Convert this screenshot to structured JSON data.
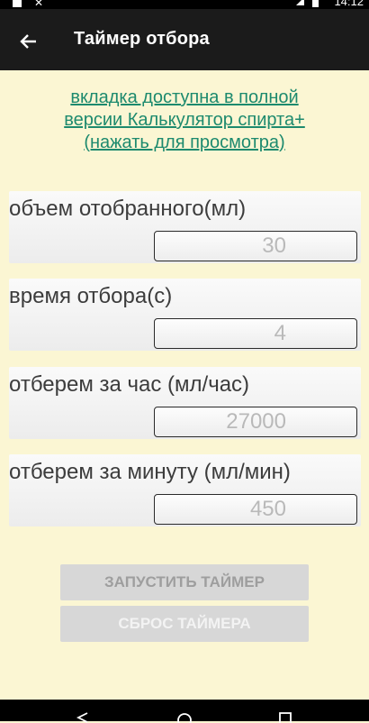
{
  "status_bar": {
    "time": "14:12"
  },
  "app_bar": {
    "title": "Таймер отбора"
  },
  "promo": {
    "line1": "вкладка доступна в полной",
    "line2": "версии Калькулятор спирта+",
    "line3": "(нажать для просмотра)"
  },
  "fields": [
    {
      "label": "объем отобранного(мл)",
      "value": "30"
    },
    {
      "label": "время отбора(с)",
      "value": "4"
    },
    {
      "label": "отберем за час (мл/час)",
      "value": "27000"
    },
    {
      "label": "отберем за минуту (мл/мин)",
      "value": "450"
    }
  ],
  "buttons": {
    "start": "ЗАПУСТИТЬ ТАЙМЕР",
    "reset": "СБРОС ТАЙМЕРА"
  },
  "colors": {
    "background": "#fbf6d3",
    "app_bar": "#1b1b1b",
    "link": "#1d8a6e"
  }
}
